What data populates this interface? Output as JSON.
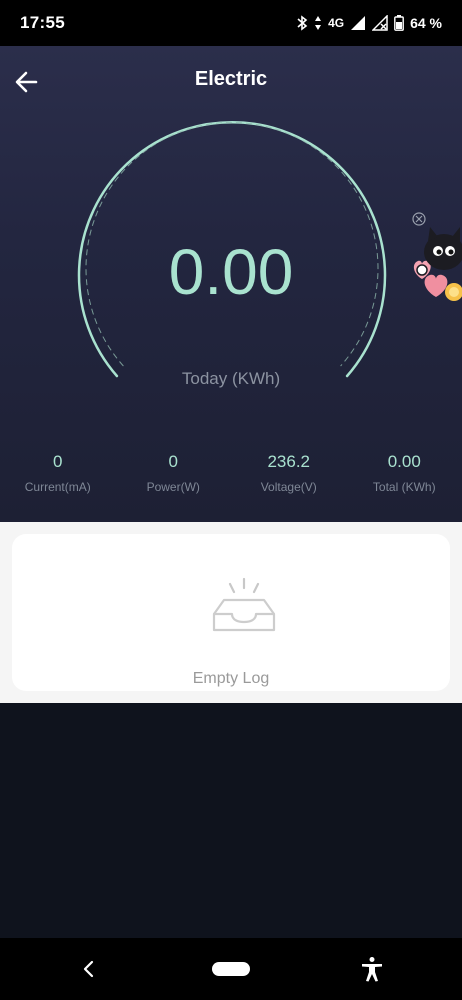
{
  "status_bar": {
    "time": "17:55",
    "network": "4G",
    "battery": "64 %"
  },
  "header": {
    "title": "Electric"
  },
  "gauge": {
    "value": "0.00",
    "label": "Today (KWh)",
    "accent_color": "#a9e2cf"
  },
  "stats": [
    {
      "value": "0",
      "label": "Current(mA)"
    },
    {
      "value": "0",
      "label": "Power(W)"
    },
    {
      "value": "236.2",
      "label": "Voltage(V)"
    },
    {
      "value": "0.00",
      "label": "Total (KWh)"
    }
  ],
  "log": {
    "empty_text": "Empty Log"
  },
  "icons": {
    "back": "back-arrow-icon",
    "close_ad": "close-circle-icon",
    "empty": "empty-inbox-icon",
    "nav_back": "nav-back-icon",
    "accessibility": "accessibility-icon"
  }
}
